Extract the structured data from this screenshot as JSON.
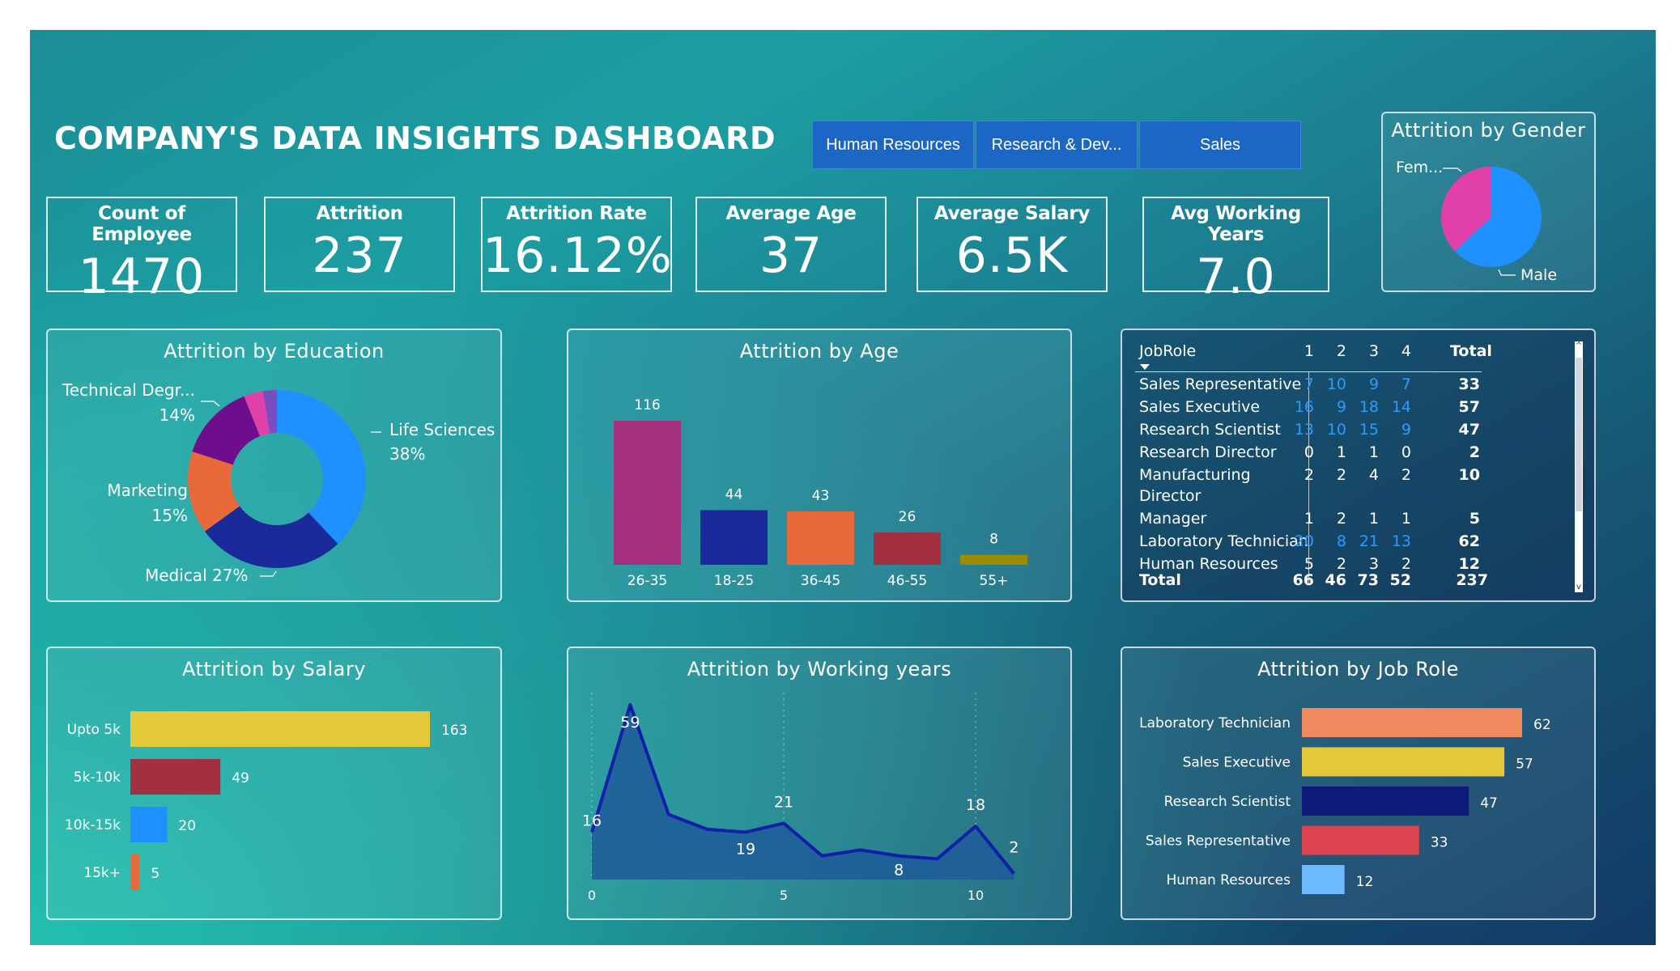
{
  "title": "COMPANY'S DATA INSIGHTS DASHBOARD",
  "slicer": [
    "Human Resources",
    "Research & Dev...",
    "Sales"
  ],
  "kpis": [
    {
      "label": "Count of Employee",
      "value": "1470"
    },
    {
      "label": "Attrition",
      "value": "237"
    },
    {
      "label": "Attrition Rate",
      "value": "16.12%"
    },
    {
      "label": "Average Age",
      "value": "37"
    },
    {
      "label": "Average Salary",
      "value": "6.5K"
    },
    {
      "label": "Avg Working Years",
      "value": "7.0"
    }
  ],
  "colors": {
    "blue": "#1e90ff",
    "pink": "#e040a8",
    "navy": "#1a2a9a",
    "orange": "#e8693a",
    "purple": "#6e0e8c",
    "violet": "#7b4ec0",
    "magenta": "#a3307e",
    "maroon": "#a23040",
    "olive": "#9e8c00",
    "yellow": "#e3c83a",
    "salmon": "#ee8a5e",
    "red": "#dc4350",
    "lightblue": "#6cb9ff",
    "darknavy": "#0d1a78",
    "area_fill": "#1f5a9a",
    "area_line": "#0f1fa8"
  },
  "chart_data": [
    {
      "id": "gender",
      "type": "pie",
      "title": "Attrition by Gender",
      "labels": [
        "Fem...",
        "Male"
      ],
      "values": [
        37,
        63
      ]
    },
    {
      "id": "education",
      "type": "pie",
      "title": "Attrition by Education",
      "slices": [
        {
          "label": "Life Sciences",
          "percent": "38%",
          "value": 38
        },
        {
          "label": "Medical 27%",
          "percent": "",
          "value": 27
        },
        {
          "label": "Marketing",
          "percent": "15%",
          "value": 15
        },
        {
          "label": "Technical Degr...",
          "percent": "14%",
          "value": 14
        },
        {
          "label": "",
          "percent": "",
          "value": 3.5
        },
        {
          "label": "",
          "percent": "",
          "value": 2.5
        }
      ]
    },
    {
      "id": "age",
      "type": "bar",
      "title": "Attrition by Age",
      "categories": [
        "26-35",
        "18-25",
        "36-45",
        "46-55",
        "55+"
      ],
      "values": [
        116,
        44,
        43,
        26,
        8
      ]
    },
    {
      "id": "salary",
      "type": "bar",
      "orientation": "horizontal",
      "title": "Attrition by Salary",
      "categories": [
        "Upto 5k",
        "5k-10k",
        "10k-15k",
        "15k+"
      ],
      "values": [
        163,
        49,
        20,
        5
      ]
    },
    {
      "id": "working_years",
      "type": "area",
      "title": "Attrition by Working years",
      "x": [
        0,
        1,
        2,
        3,
        4,
        5,
        6,
        7,
        8,
        9,
        10,
        11
      ],
      "y": [
        16,
        59,
        22,
        17,
        16,
        19,
        8,
        10,
        8,
        7,
        18,
        2
      ],
      "value_labels": [
        "16",
        "59",
        "19",
        "21",
        "8",
        "18",
        "2"
      ],
      "x_ticks": [
        "0",
        "5",
        "10"
      ],
      "xlim": [
        0,
        11
      ]
    },
    {
      "id": "job_role",
      "type": "bar",
      "orientation": "horizontal",
      "title": "Attrition by Job Role",
      "categories": [
        "Laboratory Technician",
        "Sales Executive",
        "Research Scientist",
        "Sales Representative",
        "Human Resources"
      ],
      "values": [
        62,
        57,
        47,
        33,
        12
      ]
    },
    {
      "id": "jobrole_matrix",
      "type": "table",
      "columns": [
        "JobRole",
        "1",
        "2",
        "3",
        "4",
        "Total"
      ],
      "rows": [
        {
          "role": "Sales Representative",
          "cells": [
            "7",
            "10",
            "9",
            "7"
          ],
          "total": "33"
        },
        {
          "role": "Sales Executive",
          "cells": [
            "16",
            "9",
            "18",
            "14"
          ],
          "total": "57"
        },
        {
          "role": "Research Scientist",
          "cells": [
            "13",
            "10",
            "15",
            "9"
          ],
          "total": "47"
        },
        {
          "role": "Research Director",
          "cells": [
            "0",
            "1",
            "1",
            "0"
          ],
          "total": "2"
        },
        {
          "role": "Manufacturing",
          "role2": "Director",
          "cells": [
            "2",
            "2",
            "4",
            "2"
          ],
          "total": "10"
        },
        {
          "role": "Manager",
          "cells": [
            "1",
            "2",
            "1",
            "1"
          ],
          "total": "5"
        },
        {
          "role": "Laboratory Technician",
          "cells": [
            "20",
            "8",
            "21",
            "13"
          ],
          "total": "62"
        },
        {
          "role": "Human Resources",
          "cells": [
            "5",
            "2",
            "3",
            "2"
          ],
          "total": "12"
        }
      ],
      "footer": {
        "label": "Total",
        "cells": [
          "66",
          "46",
          "73",
          "52"
        ],
        "total": "237"
      }
    }
  ]
}
